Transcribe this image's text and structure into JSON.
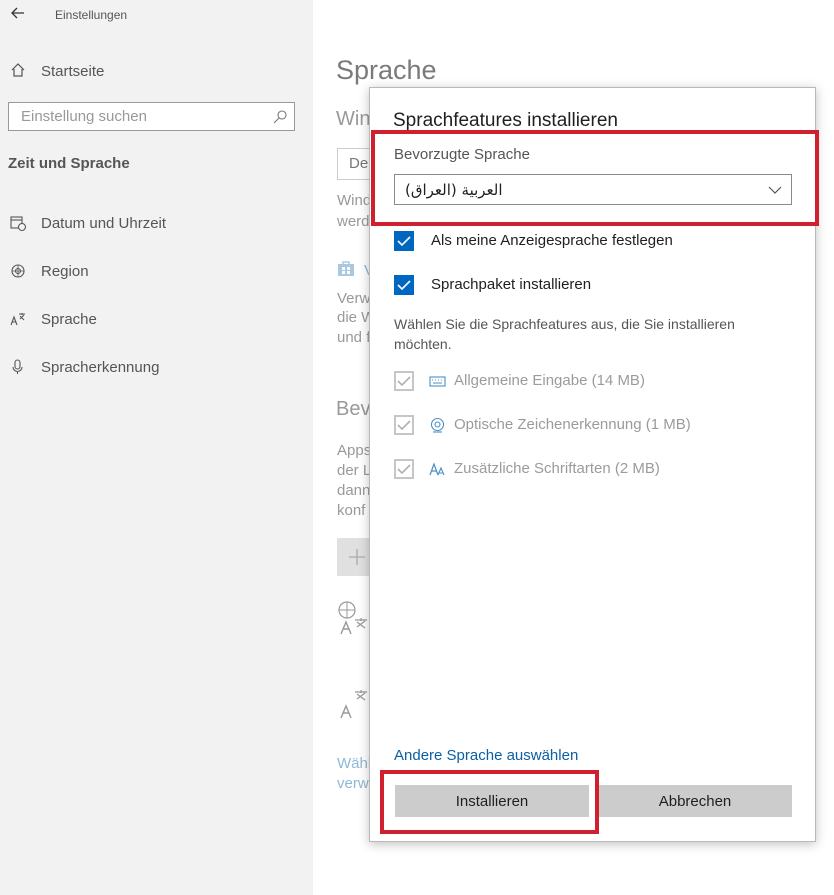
{
  "window": {
    "title": "Einstellungen"
  },
  "sidebar": {
    "home_label": "Startseite",
    "search_placeholder": "Einstellung suchen",
    "section_title": "Zeit und Sprache",
    "items": [
      {
        "label": "Datum und Uhrzeit",
        "icon": "calendar-clock-icon"
      },
      {
        "label": "Region",
        "icon": "globe-icon"
      },
      {
        "label": "Sprache",
        "icon": "language-icon"
      },
      {
        "label": "Spracherkennung",
        "icon": "microphone-icon"
      }
    ]
  },
  "page": {
    "title": "Sprache",
    "fragments": {
      "win": "Win",
      "de": "De",
      "wind": "Wind",
      "werd": "werd",
      "v": "V",
      "verw": "Verw",
      "die_w": "die W",
      "und_f": "und f",
      "bevo": "Bevo",
      "apps": "Apps",
      "der_l": "der L",
      "dann": "dann",
      "konf": "konf",
      "waeh": "Wähl",
      "verw2": "verw"
    }
  },
  "dialog": {
    "title": "Sprachfeatures installieren",
    "preferred_language_label": "Bevorzugte Sprache",
    "selected_language": "العربية (العراق)",
    "options": [
      {
        "label": "Als meine Anzeigesprache festlegen",
        "checked": true
      },
      {
        "label": "Sprachpaket installieren",
        "checked": true
      }
    ],
    "description": "Wählen Sie die Sprachfeatures aus, die Sie installieren möchten.",
    "features": [
      {
        "label": "Allgemeine Eingabe (14 MB)",
        "checked": true,
        "icon": "keyboard-icon"
      },
      {
        "label": "Optische Zeichenerkennung (1 MB)",
        "checked": true,
        "icon": "camera-icon"
      },
      {
        "label": "Zusätzliche Schriftarten (2 MB)",
        "checked": true,
        "icon": "font-icon"
      }
    ],
    "other_language_link": "Andere Sprache auswählen",
    "install_label": "Installieren",
    "cancel_label": "Abbrechen"
  },
  "colors": {
    "accent": "#0067c0",
    "highlight": "#d0202f",
    "link": "#0a5fa3"
  }
}
